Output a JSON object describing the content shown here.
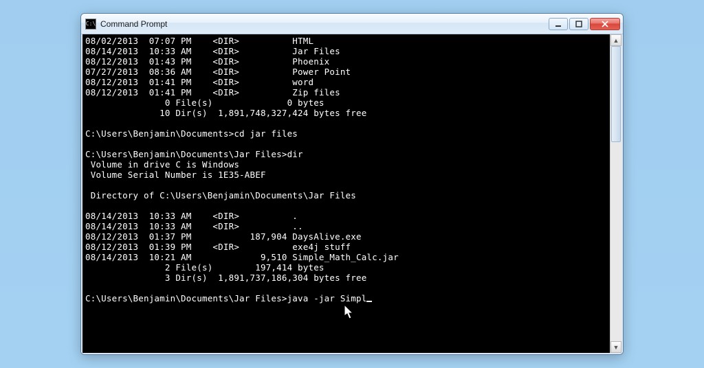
{
  "window": {
    "title": "Command Prompt",
    "icon_label": "C:\\"
  },
  "console": {
    "lines": [
      "08/02/2013  07:07 PM    <DIR>          HTML",
      "08/14/2013  10:33 AM    <DIR>          Jar Files",
      "08/12/2013  01:43 PM    <DIR>          Phoenix",
      "07/27/2013  08:36 AM    <DIR>          Power Point",
      "08/12/2013  01:41 PM    <DIR>          word",
      "08/12/2013  01:41 PM    <DIR>          Zip files",
      "               0 File(s)              0 bytes",
      "              10 Dir(s)  1,891,748,327,424 bytes free",
      "",
      "C:\\Users\\Benjamin\\Documents>cd jar files",
      "",
      "C:\\Users\\Benjamin\\Documents\\Jar Files>dir",
      " Volume in drive C is Windows",
      " Volume Serial Number is 1E35-ABEF",
      "",
      " Directory of C:\\Users\\Benjamin\\Documents\\Jar Files",
      "",
      "08/14/2013  10:33 AM    <DIR>          .",
      "08/14/2013  10:33 AM    <DIR>          ..",
      "08/12/2013  01:37 PM           187,904 DaysAlive.exe",
      "08/12/2013  01:39 PM    <DIR>          exe4j stuff",
      "08/14/2013  10:21 AM             9,510 Simple_Math_Calc.jar",
      "               2 File(s)        197,414 bytes",
      "               3 Dir(s)  1,891,737,186,304 bytes free",
      ""
    ],
    "prompt": "C:\\Users\\Benjamin\\Documents\\Jar Files>",
    "typed": "java -jar Simpl"
  }
}
